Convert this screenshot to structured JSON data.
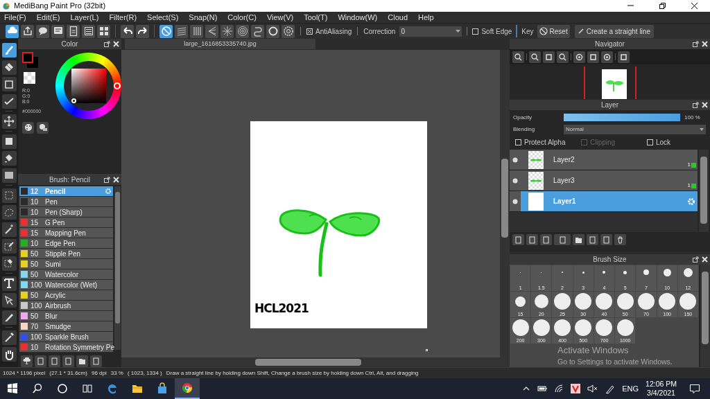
{
  "window": {
    "title": "MediBang Paint Pro (32bit)"
  },
  "menu": [
    "File(F)",
    "Edit(E)",
    "Layer(L)",
    "Filter(R)",
    "Select(S)",
    "Snap(N)",
    "Color(C)",
    "View(V)",
    "Tool(T)",
    "Window(W)",
    "Cloud",
    "Help"
  ],
  "toolbar": {
    "buttons": [
      {
        "kind": "cloud",
        "selected": true
      },
      {
        "kind": "share",
        "selected": false
      },
      {
        "kind": "chat",
        "selected": false
      },
      {
        "kind": "comment",
        "selected": false
      },
      {
        "kind": "page",
        "selected": false
      },
      {
        "kind": "list",
        "selected": false
      },
      {
        "kind": "grid",
        "selected": false
      },
      {
        "kind": "undo",
        "selected": false
      },
      {
        "kind": "redo",
        "selected": false
      },
      {
        "kind": "none",
        "selected": true
      },
      {
        "kind": "parallel",
        "selected": false
      },
      {
        "kind": "vertical",
        "selected": false
      },
      {
        "kind": "vanishing",
        "selected": false
      },
      {
        "kind": "radial",
        "selected": false
      },
      {
        "kind": "concentric",
        "selected": false
      },
      {
        "kind": "curve",
        "selected": false
      },
      {
        "kind": "ellipse",
        "selected": false
      },
      {
        "kind": "gear",
        "selected": false
      }
    ],
    "antialiasing": {
      "label": "AntiAliasing",
      "checked": true
    },
    "correction": {
      "label": "Correction",
      "value": "0"
    },
    "soft_edge": {
      "label": "Soft Edge",
      "checked": false
    },
    "key_label": "Key",
    "reset": "Reset",
    "straight_line": "Create a straight line"
  },
  "tools": [
    {
      "kind": "brush",
      "selected": true
    },
    {
      "kind": "eraser",
      "selected": false
    },
    {
      "kind": "rect",
      "selected": false
    },
    {
      "kind": "check",
      "selected": false
    },
    {
      "kind": "move",
      "selected": false
    },
    {
      "kind": "fill",
      "selected": false
    },
    {
      "kind": "bucket",
      "selected": false
    },
    {
      "kind": "gradient",
      "selected": false
    },
    {
      "kind": "select",
      "selected": false
    },
    {
      "kind": "lasso",
      "selected": false
    },
    {
      "kind": "wand",
      "selected": false
    },
    {
      "kind": "selpen",
      "selected": false
    },
    {
      "kind": "selerase",
      "selected": false
    },
    {
      "kind": "text",
      "selected": false
    },
    {
      "kind": "operation",
      "selected": false
    },
    {
      "kind": "knife",
      "selected": false
    },
    {
      "kind": "dropper",
      "selected": false
    },
    {
      "kind": "hand",
      "selected": false
    }
  ],
  "color_panel": {
    "title": "Color",
    "rgb": [
      "R:0",
      "G:0",
      "B:0"
    ],
    "hex": "#000000"
  },
  "brush_panel": {
    "title": "Brush: Pencil",
    "brushes": [
      {
        "size": "12",
        "name": "Pencil",
        "color": "#2a2a2a",
        "selected": true
      },
      {
        "size": "10",
        "name": "Pen",
        "color": "#2a2a2a",
        "selected": false
      },
      {
        "size": "10",
        "name": "Pen (Sharp)",
        "color": "#2a2a2a",
        "selected": false
      },
      {
        "size": "15",
        "name": "G Pen",
        "color": "#e83030",
        "selected": false
      },
      {
        "size": "15",
        "name": "Mapping Pen",
        "color": "#e83030",
        "selected": false
      },
      {
        "size": "10",
        "name": "Edge Pen",
        "color": "#20b020",
        "selected": false
      },
      {
        "size": "50",
        "name": "Stipple Pen",
        "color": "#e8d020",
        "selected": false
      },
      {
        "size": "50",
        "name": "Sumi",
        "color": "#e8d020",
        "selected": false
      },
      {
        "size": "50",
        "name": "Watercolor",
        "color": "#80d8f0",
        "selected": false
      },
      {
        "size": "100",
        "name": "Watercolor (Wet)",
        "color": "#80d8f0",
        "selected": false
      },
      {
        "size": "50",
        "name": "Acrylic",
        "color": "#e8d020",
        "selected": false
      },
      {
        "size": "100",
        "name": "Airbrush",
        "color": "#c8c8c8",
        "selected": false
      },
      {
        "size": "50",
        "name": "Blur",
        "color": "#f0a8f0",
        "selected": false
      },
      {
        "size": "70",
        "name": "Smudge",
        "color": "#f8d8c0",
        "selected": false
      },
      {
        "size": "100",
        "name": "Sparkle Brush",
        "color": "#3050e8",
        "selected": false
      },
      {
        "size": "10",
        "name": "Rotation Symmetry Pe",
        "color": "#e83030",
        "selected": false
      }
    ]
  },
  "document": {
    "tab": "large_1616853335740.jpg",
    "handwriting": "HCL2021"
  },
  "navigator": {
    "title": "Navigator"
  },
  "layer_panel": {
    "title": "Layer",
    "opacity_label": "Opacity",
    "opacity": {
      "level": 1
    },
    "opacity_reading": "100 %",
    "blending_label": "Blending",
    "blending": "Normal",
    "options": [
      {
        "label": "Protect Alpha",
        "checked": false,
        "disabled": false
      },
      {
        "label": "Clipping",
        "checked": false,
        "disabled": true
      },
      {
        "label": "Lock",
        "checked": false,
        "disabled": false
      }
    ],
    "layers": [
      {
        "name": "Layer2",
        "badge": "1",
        "selected": false
      },
      {
        "name": "Layer3",
        "badge": "1",
        "selected": false
      },
      {
        "name": "Layer1",
        "selected": true
      }
    ]
  },
  "brush_size": {
    "title": "Brush Size",
    "sizes": [
      "1",
      "1.5",
      "2",
      "3",
      "4",
      "5",
      "7",
      "10",
      "12",
      "15",
      "20",
      "25",
      "30",
      "40",
      "50",
      "70",
      "100",
      "150",
      "200",
      "300",
      "400",
      "500",
      "700",
      "1000"
    ]
  },
  "activation": {
    "title": "Activate Windows",
    "subtitle": "Go to Settings to activate Windows."
  },
  "status_bar": {
    "size": "1024 * 1196 pixel",
    "physical": "(27.1 * 31.6cm)",
    "dpi": "96 dpi",
    "zoom": "33 %",
    "cursor": "( 1023, 1334 )",
    "hint": "Draw a straight line by holding down Shift, Change a brush size by holding down Ctrl, Alt, and dragging"
  },
  "taskbar": {
    "apps": [
      {
        "kind": "start",
        "active": false
      },
      {
        "kind": "search",
        "active": false
      },
      {
        "kind": "cortana",
        "active": false
      },
      {
        "kind": "taskview",
        "active": false
      },
      {
        "kind": "edge",
        "active": false
      },
      {
        "kind": "folder",
        "active": false
      },
      {
        "kind": "store",
        "active": false
      },
      {
        "kind": "chrome",
        "active": true
      }
    ],
    "language": "ENG",
    "time": "12:06 PM",
    "date": "3/4/2021"
  }
}
